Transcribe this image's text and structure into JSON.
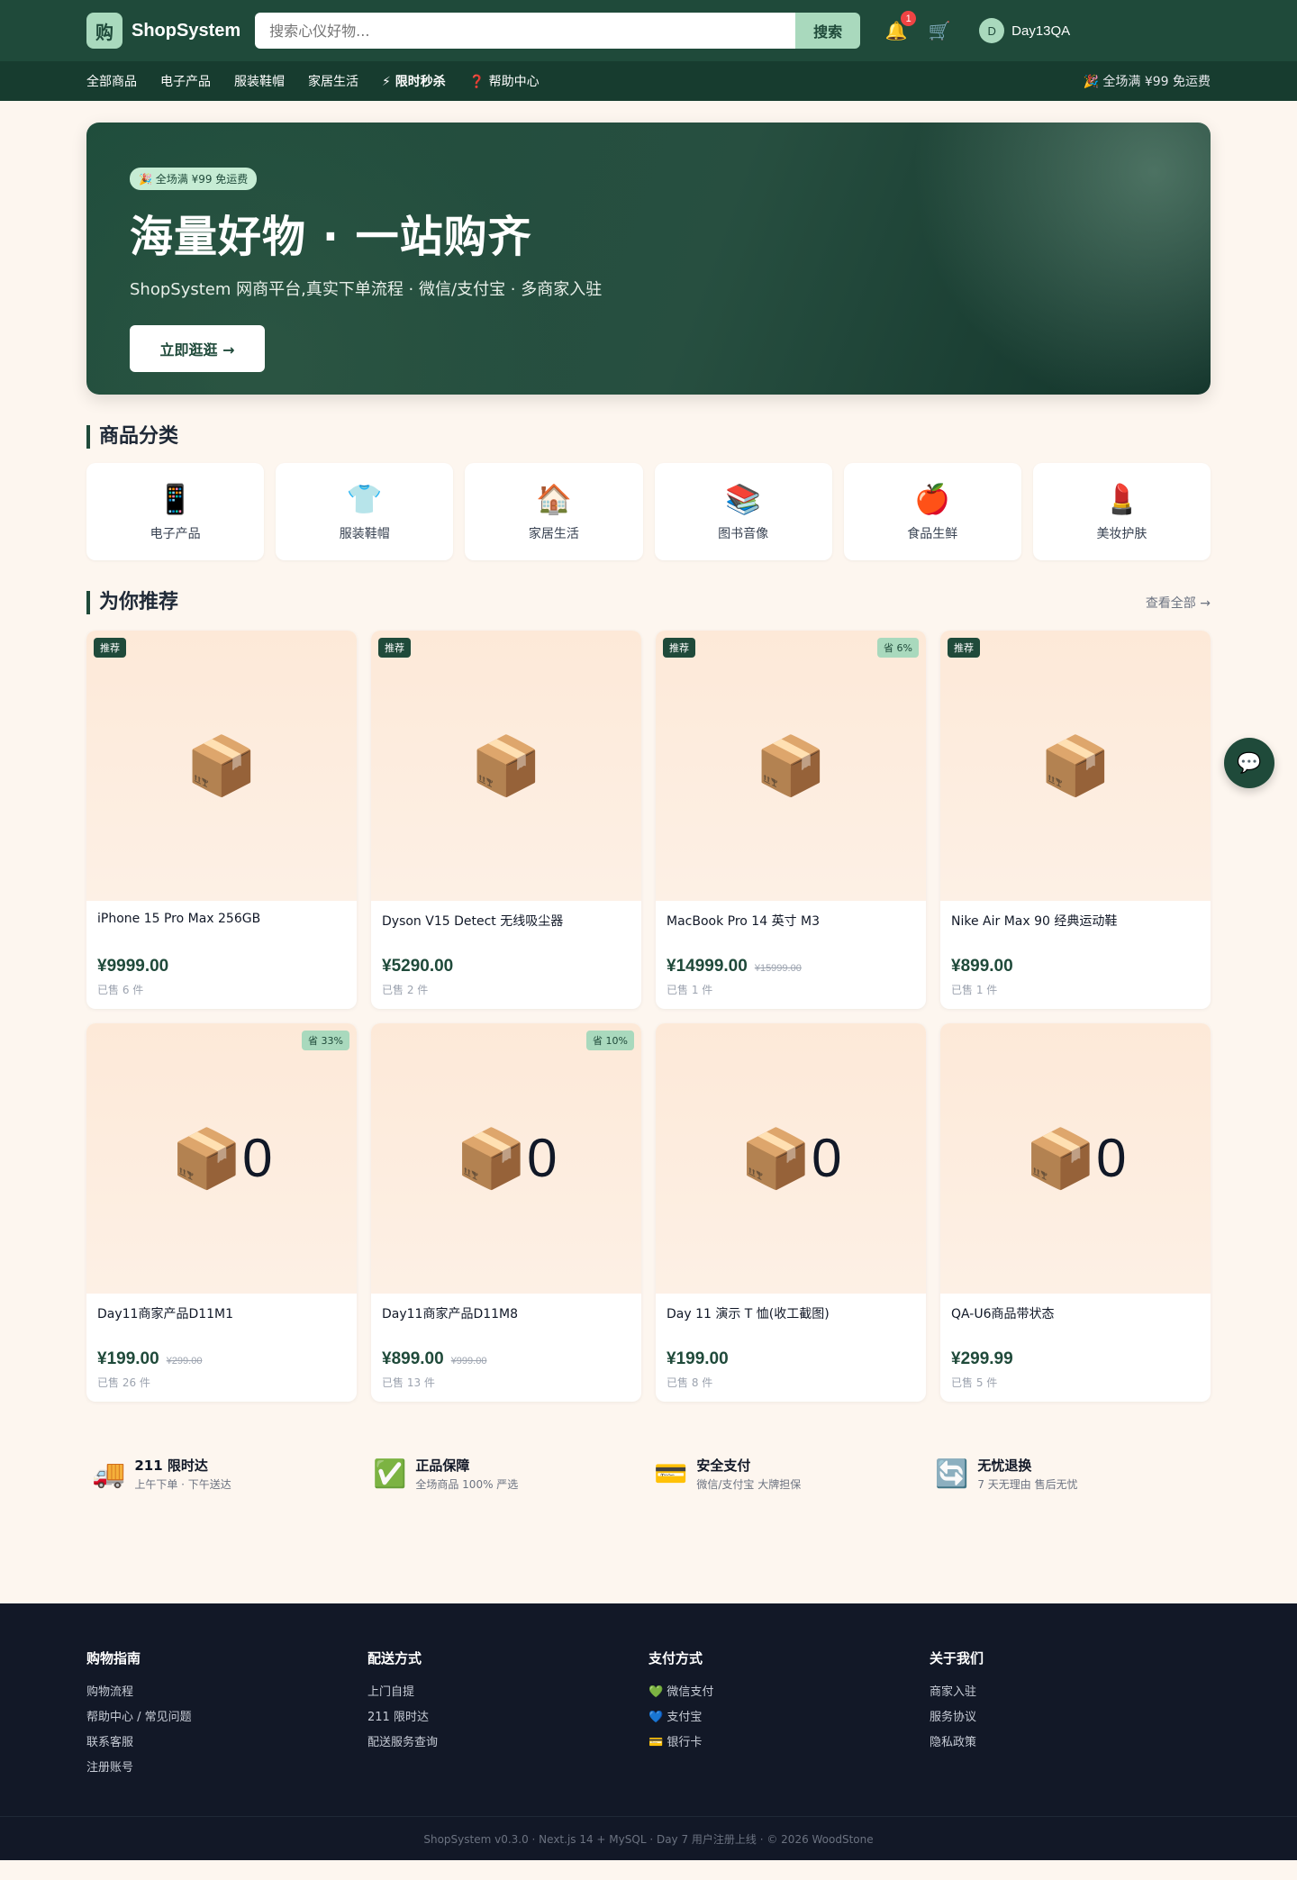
{
  "header": {
    "logo_mark": "购",
    "brand": "ShopSystem",
    "search_placeholder": "搜索心仪好物...",
    "search_button": "搜索",
    "bell_icon": "🔔",
    "bell_badge": "1",
    "cart_icon": "🛒",
    "avatar_letter": "D",
    "username": "Day13QA"
  },
  "nav": {
    "items": [
      "全部商品",
      "电子产品",
      "服装鞋帽",
      "家居生活",
      "⚡ 限时秒杀",
      "❓ 帮助中心"
    ],
    "promo": "🎉 全场满 ¥99 免运费"
  },
  "hero": {
    "badge": "🎉 全场满 ¥99 免运费",
    "title": "海量好物 · 一站购齐",
    "subtitle": "ShopSystem 网商平台,真实下单流程 · 微信/支付宝 · 多商家入驻",
    "button": "立即逛逛 →"
  },
  "categories": {
    "title": "商品分类",
    "items": [
      {
        "icon": "📱",
        "label": "电子产品"
      },
      {
        "icon": "👕",
        "label": "服装鞋帽"
      },
      {
        "icon": "🏠",
        "label": "家居生活"
      },
      {
        "icon": "📚",
        "label": "图书音像"
      },
      {
        "icon": "🍎",
        "label": "食品生鲜"
      },
      {
        "icon": "💄",
        "label": "美妆护肤"
      }
    ]
  },
  "recommend": {
    "title": "为你推荐",
    "view_all": "查看全部 →",
    "products": [
      {
        "tag": "推荐",
        "save": "",
        "icon": "📦",
        "zero": "",
        "name": "iPhone 15 Pro Max 256GB",
        "price": "¥9999.00",
        "original": "",
        "sold": "已售 6 件"
      },
      {
        "tag": "推荐",
        "save": "",
        "icon": "📦",
        "zero": "",
        "name": "Dyson V15 Detect 无线吸尘器",
        "price": "¥5290.00",
        "original": "",
        "sold": "已售 2 件"
      },
      {
        "tag": "推荐",
        "save": "省 6%",
        "icon": "📦",
        "zero": "",
        "name": "MacBook Pro 14 英寸 M3",
        "price": "¥14999.00",
        "original": "¥15999.00",
        "sold": "已售 1 件"
      },
      {
        "tag": "推荐",
        "save": "",
        "icon": "📦",
        "zero": "",
        "name": "Nike Air Max 90 经典运动鞋",
        "price": "¥899.00",
        "original": "",
        "sold": "已售 1 件"
      },
      {
        "tag": "",
        "save": "省 33%",
        "icon": "📦",
        "zero": "0",
        "name": "Day11商家产品D11M1",
        "price": "¥199.00",
        "original": "¥299.00",
        "sold": "已售 26 件"
      },
      {
        "tag": "",
        "save": "省 10%",
        "icon": "📦",
        "zero": "0",
        "name": "Day11商家产品D11M8",
        "price": "¥899.00",
        "original": "¥999.00",
        "sold": "已售 13 件"
      },
      {
        "tag": "",
        "save": "",
        "icon": "📦",
        "zero": "0",
        "name": "Day 11 演示 T 恤(收工截图)",
        "price": "¥199.00",
        "original": "",
        "sold": "已售 8 件"
      },
      {
        "tag": "",
        "save": "",
        "icon": "📦",
        "zero": "0",
        "name": "QA-U6商品带状态",
        "price": "¥299.99",
        "original": "",
        "sold": "已售 5 件"
      }
    ]
  },
  "features": [
    {
      "icon": "🚚",
      "title": "211 限时达",
      "desc": "上午下单 · 下午送达"
    },
    {
      "icon": "✅",
      "title": "正品保障",
      "desc": "全场商品 100% 严选"
    },
    {
      "icon": "💳",
      "title": "安全支付",
      "desc": "微信/支付宝 大牌担保"
    },
    {
      "icon": "🔄",
      "title": "无忧退换",
      "desc": "7 天无理由 售后无忧"
    }
  ],
  "footer": {
    "columns": [
      {
        "title": "购物指南",
        "links": [
          "购物流程",
          "帮助中心 / 常见问题",
          "联系客服",
          "注册账号"
        ]
      },
      {
        "title": "配送方式",
        "links": [
          "上门自提",
          "211 限时达",
          "配送服务查询"
        ]
      },
      {
        "title": "支付方式",
        "links": [
          "💚 微信支付",
          "💙 支付宝",
          "💳 银行卡"
        ]
      },
      {
        "title": "关于我们",
        "links": [
          "商家入驻",
          "服务协议",
          "隐私政策"
        ]
      }
    ],
    "copyright": "ShopSystem v0.3.0 · Next.js 14 + MySQL · Day 7 用户注册上线 · © 2026 WoodStone"
  },
  "chat_icon": "💬",
  "colors": {
    "primary": "#1f4a3a",
    "accent": "#a9d9bd",
    "page_bg": "#fdf6ef",
    "footer_bg": "#121827"
  }
}
